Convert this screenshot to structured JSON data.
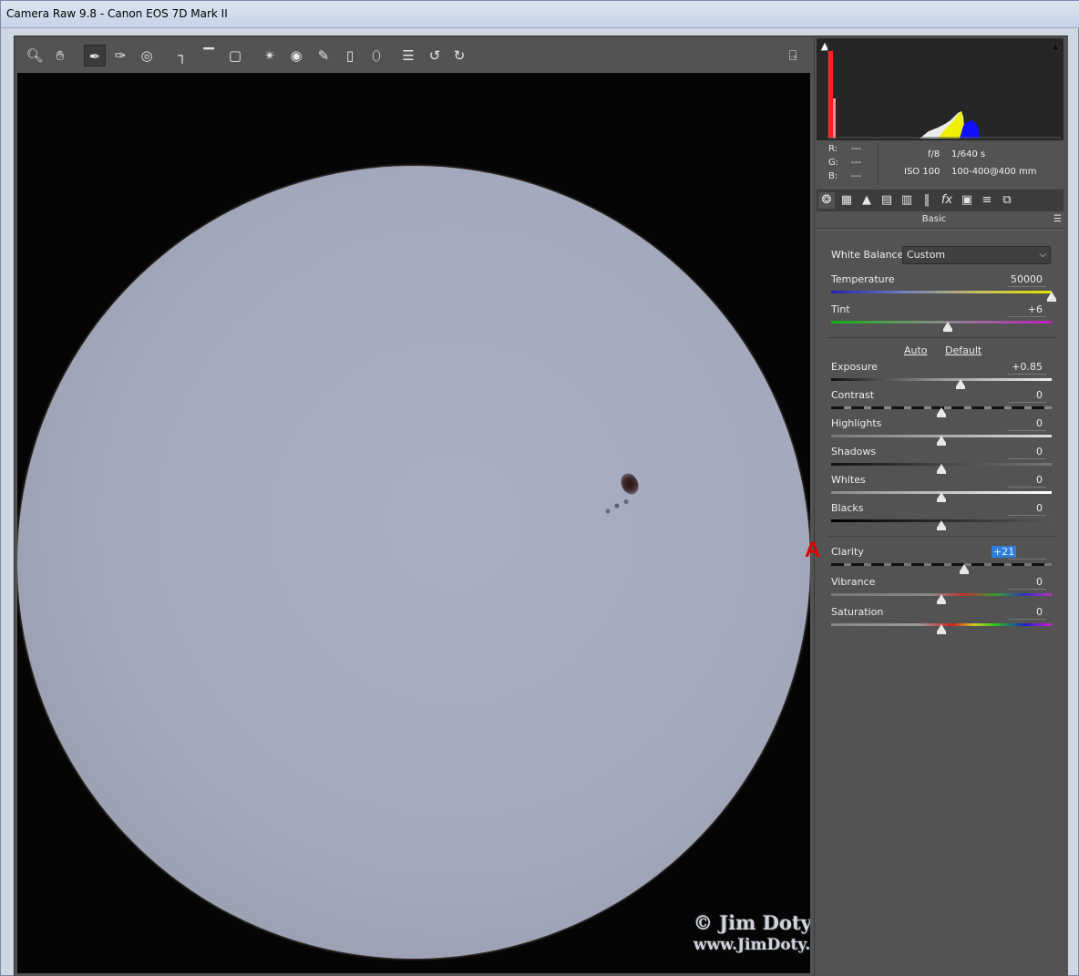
{
  "window": {
    "title": "Camera Raw 9.8  -  Canon EOS 7D Mark II"
  },
  "toolbar": {
    "tools": [
      {
        "name": "zoom-tool",
        "icon": "magnifier-icon"
      },
      {
        "name": "hand-tool",
        "icon": "hand-icon"
      },
      {
        "name": "white-balance-tool",
        "icon": "eyedropper-icon",
        "active": true
      },
      {
        "name": "color-sampler-tool",
        "icon": "color-sampler-icon"
      },
      {
        "name": "targeted-adjustment-tool",
        "icon": "target-icon"
      },
      {
        "name": "crop-tool",
        "icon": "crop-icon"
      },
      {
        "name": "straighten-tool",
        "icon": "level-icon"
      },
      {
        "name": "transform-tool",
        "icon": "transform-icon"
      },
      {
        "name": "spot-removal-tool",
        "icon": "spot-removal-icon"
      },
      {
        "name": "red-eye-tool",
        "icon": "red-eye-icon"
      },
      {
        "name": "adjustment-brush-tool",
        "icon": "brush-icon"
      },
      {
        "name": "graduated-filter-tool",
        "icon": "gradient-icon"
      },
      {
        "name": "radial-filter-tool",
        "icon": "ellipse-icon"
      },
      {
        "name": "preferences-button",
        "icon": "list-icon"
      },
      {
        "name": "rotate-left-button",
        "icon": "rotate-ccw-icon"
      },
      {
        "name": "rotate-right-button",
        "icon": "rotate-cw-icon"
      }
    ],
    "fullscreen_icon": "exit-fullscreen-icon"
  },
  "watermark": {
    "line1": "© Jim Doty, Jr.",
    "line2": "www.JimDoty.com"
  },
  "annotation": {
    "marker": "A",
    "color": "#e00000"
  },
  "readout": {
    "r_label": "R:",
    "r_value": "---",
    "g_label": "G:",
    "g_value": "---",
    "b_label": "B:",
    "b_value": "---",
    "aperture": "f/8",
    "shutter": "1/640 s",
    "iso": "ISO 100",
    "lens": "100-400@400 mm"
  },
  "panel": {
    "title": "Basic",
    "tabs": [
      "basic-icon",
      "tone-curve-icon",
      "detail-icon",
      "hsl-icon",
      "split-toning-icon",
      "lens-corrections-icon",
      "effects-icon",
      "camera-calibration-icon",
      "presets-icon",
      "snapshots-icon"
    ],
    "white_balance_label": "White Balance:",
    "white_balance_value": "Custom",
    "auto_label": "Auto",
    "default_label": "Default"
  },
  "sliders": {
    "temperature": {
      "label": "Temperature",
      "value": "50000",
      "level": 1.0
    },
    "tint": {
      "label": "Tint",
      "value": "+6",
      "level": 0.53
    },
    "exposure": {
      "label": "Exposure",
      "value": "+0.85",
      "level": 0.585
    },
    "contrast": {
      "label": "Contrast",
      "value": "0",
      "level": 0.5
    },
    "highlights": {
      "label": "Highlights",
      "value": "0",
      "level": 0.5
    },
    "shadows": {
      "label": "Shadows",
      "value": "0",
      "level": 0.5
    },
    "whites": {
      "label": "Whites",
      "value": "0",
      "level": 0.5
    },
    "blacks": {
      "label": "Blacks",
      "value": "0",
      "level": 0.5
    },
    "clarity": {
      "label": "Clarity",
      "value": "+21",
      "level": 0.605,
      "selected": true
    },
    "vibrance": {
      "label": "Vibrance",
      "value": "0",
      "level": 0.5
    },
    "saturation": {
      "label": "Saturation",
      "value": "0",
      "level": 0.5
    }
  },
  "colors": {
    "panel_bg": "#535353",
    "selection": "#2e7fdc",
    "histogram_red": "#ff2020",
    "histogram_yellow": "#f0f000",
    "histogram_blue": "#1010ff"
  }
}
